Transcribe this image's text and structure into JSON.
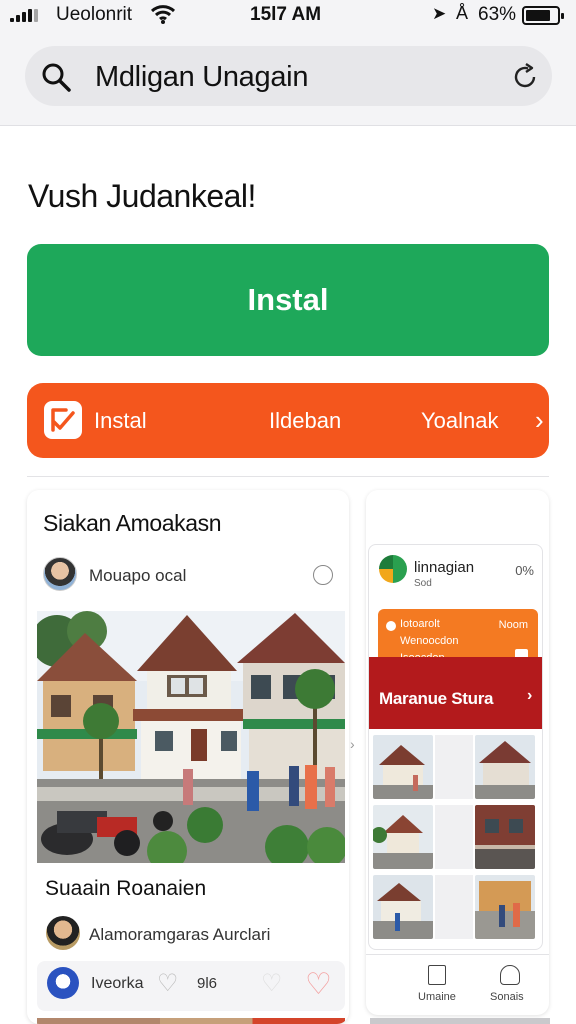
{
  "status_bar": {
    "carrier": "Ueolonrit",
    "time": "15l7 AM",
    "battery_percent": "63%",
    "battery_level": 0.63
  },
  "search": {
    "query": "Mdligan Unagain"
  },
  "heading": "Vush Judankeal!",
  "install_button": "Instal",
  "orange_bar": {
    "label_left": "Instal",
    "label_middle": "Ildeban",
    "label_right": "Yoalnak",
    "accent": "#f4561d"
  },
  "left_card": {
    "title": "Siakan Amoakasn",
    "user_name": "Mouapo ocal",
    "subtitle": "Suaain Roanaien",
    "author": "Alamoramgaras Aurclari",
    "footer_name": "Iveorka",
    "footer_count": "9l6"
  },
  "right_card": {
    "app_name": "linnagian",
    "app_sub": "Sod",
    "app_percent": "0%",
    "promo": {
      "line1": "Iotoarolt",
      "line2": "Wenoocdon",
      "line3": "Isoocdon",
      "tag": "Noom"
    },
    "banner": "Maranue Stura",
    "tabs": [
      "Umaine",
      "Sonais"
    ]
  },
  "colors": {
    "green": "#1ea85a",
    "orange": "#f4561d",
    "red": "#b31a1c"
  }
}
